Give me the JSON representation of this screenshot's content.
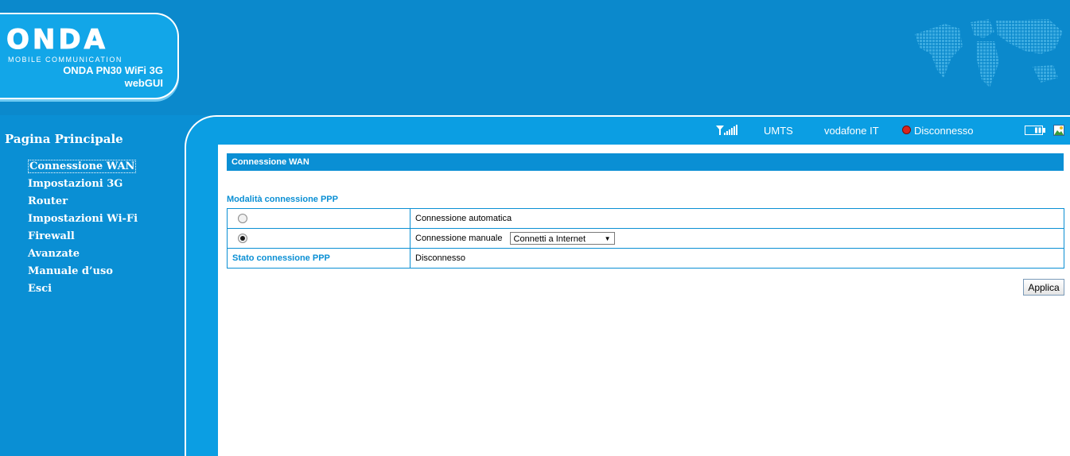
{
  "header": {
    "logo_text": "ONDA",
    "logo_sub": "MOBILE COMMUNICATION",
    "device_line1": "ONDA PN30 WiFi 3G",
    "device_line2": "webGUI"
  },
  "sidebar": {
    "title": "Pagina Principale",
    "items": [
      {
        "label": "Connessione WAN"
      },
      {
        "label": "Impostazioni 3G"
      },
      {
        "label": "Router"
      },
      {
        "label": "Impostazioni Wi-Fi"
      },
      {
        "label": "Firewall"
      },
      {
        "label": "Avanzate"
      },
      {
        "label": "Manuale d’uso"
      },
      {
        "label": "Esci"
      }
    ]
  },
  "status": {
    "network_type": "UMTS",
    "operator": "vodafone IT",
    "connection": "Disconnesso"
  },
  "main": {
    "section_title": "Connessione WAN",
    "ppp_mode_label": "Modalità connessione PPP",
    "rows": {
      "auto_label": "Connessione automatica",
      "manual_label": "Connessione manuale",
      "manual_select_value": "Connetti a Internet",
      "state_label": "Stato connessione PPP",
      "state_value": "Disconnesso"
    },
    "apply_label": "Applica"
  },
  "colors": {
    "primary": "#0a8fd4",
    "header": "#0b89cc",
    "logo_panel": "#12a6e8",
    "status_dot": "#d7261e"
  }
}
